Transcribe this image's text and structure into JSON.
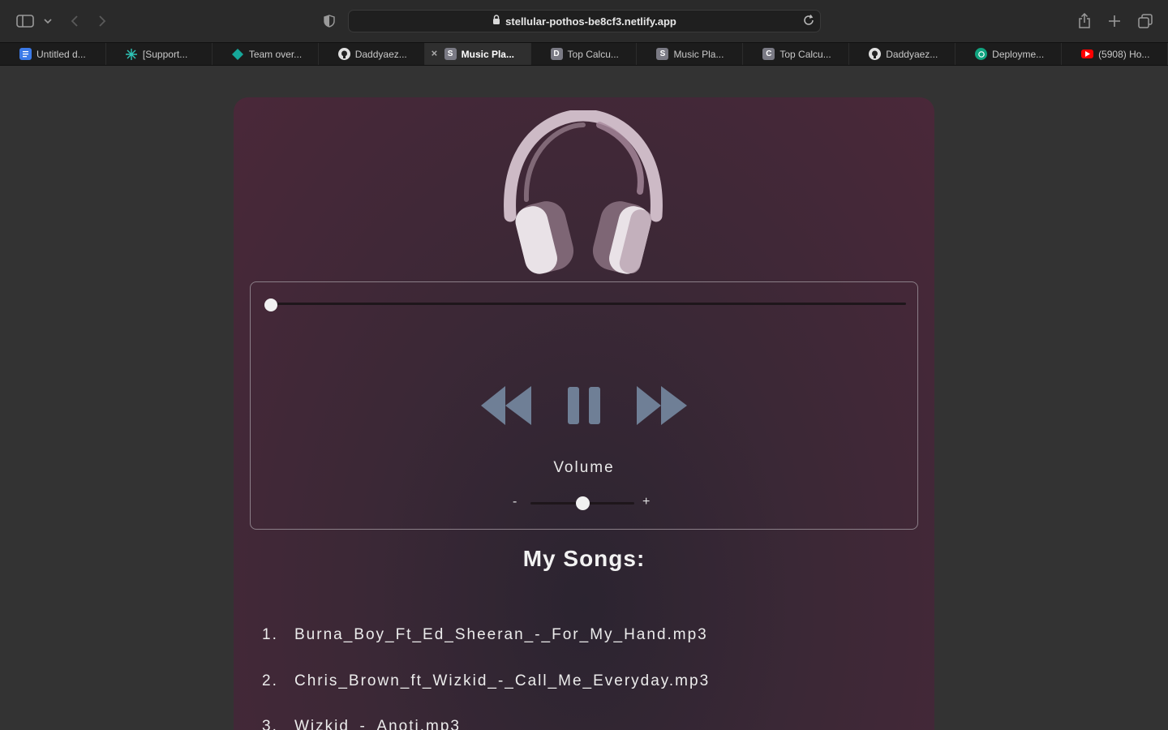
{
  "browser": {
    "url": "stellular-pothos-be8cf3.netlify.app",
    "tabs": [
      {
        "label": "Untitled d...",
        "icon": "google-docs-icon",
        "color": "#3b7ae8",
        "letter": ""
      },
      {
        "label": "[Support...",
        "icon": "clickup-icon",
        "color": "#2ec4b6",
        "letter": ""
      },
      {
        "label": "Team over...",
        "icon": "diamond-icon",
        "color": "#16a79a",
        "letter": ""
      },
      {
        "label": "Daddyaez...",
        "icon": "github-icon",
        "color": "#e0e0e0",
        "letter": ""
      },
      {
        "label": "Music Pla...",
        "icon": "site-s-icon",
        "color": "#7a7a84",
        "letter": "S",
        "active": true
      },
      {
        "label": "Top Calcu...",
        "icon": "site-d-icon",
        "color": "#7a7a84",
        "letter": "D"
      },
      {
        "label": "Music Pla...",
        "icon": "site-s-icon",
        "color": "#7a7a84",
        "letter": "S"
      },
      {
        "label": "Top Calcu...",
        "icon": "site-c-icon",
        "color": "#7a7a84",
        "letter": "C"
      },
      {
        "label": "Daddyaez...",
        "icon": "github-icon",
        "color": "#e0e0e0",
        "letter": ""
      },
      {
        "label": "Deployme...",
        "icon": "openai-icon",
        "color": "#10a37f",
        "letter": ""
      },
      {
        "label": "(5908) Ho...",
        "icon": "youtube-icon",
        "color": "#ff0000",
        "letter": ""
      }
    ]
  },
  "player": {
    "progress": 0,
    "volume_label": "Volume",
    "volume_minus": "-",
    "volume_plus": "+",
    "volume_level": 0.5,
    "controls": [
      "rewind-icon",
      "pause-icon",
      "fast-forward-icon"
    ],
    "control_color": "#6f7f96"
  },
  "songs": {
    "title": "My Songs:",
    "items": [
      {
        "num": "1.",
        "name": "Burna_Boy_Ft_Ed_Sheeran_-_For_My_Hand.mp3"
      },
      {
        "num": "2.",
        "name": "Chris_Brown_ft_Wizkid_-_Call_Me_Everyday.mp3"
      },
      {
        "num": "3.",
        "name": "Wizkid_-_Anoti.mp3"
      }
    ]
  }
}
